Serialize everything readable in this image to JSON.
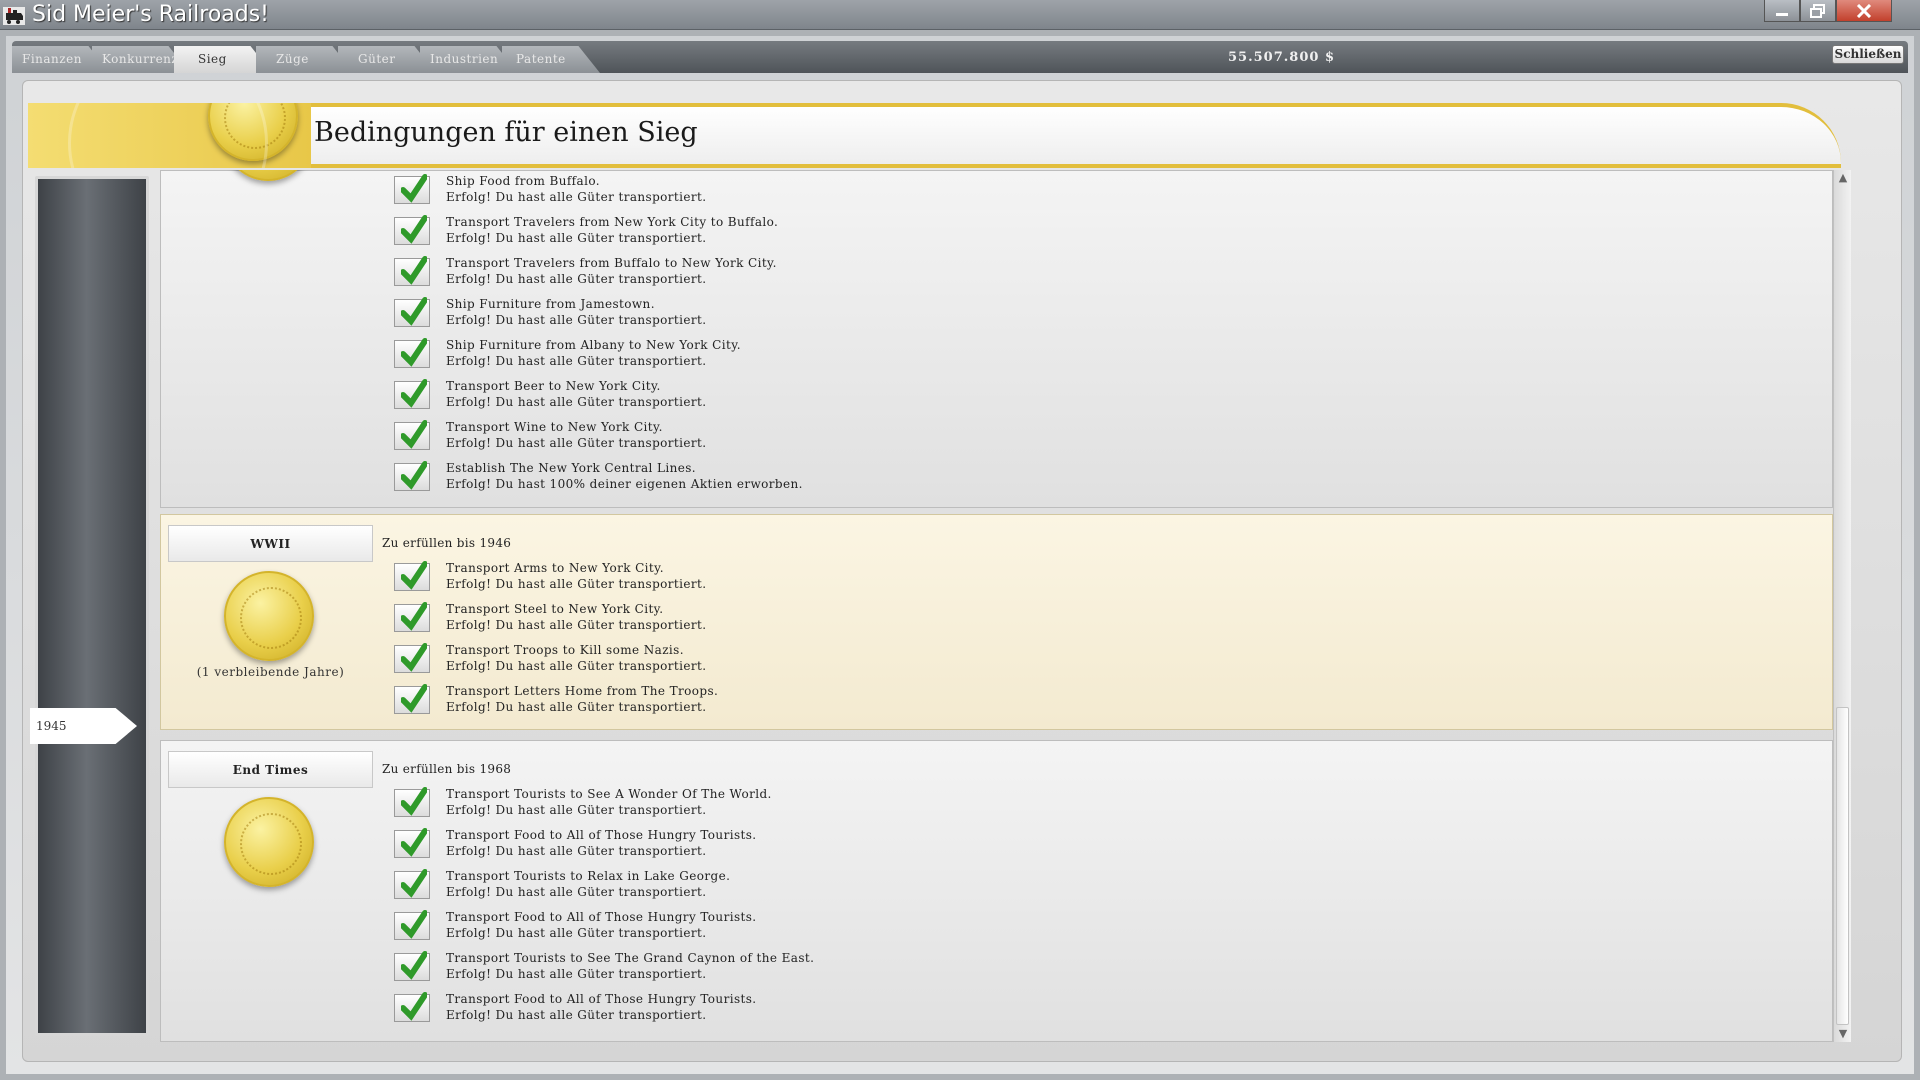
{
  "window": {
    "title": "Sid Meier's Railroads!",
    "icon": "locomotive-icon",
    "controls": [
      "minimize-icon",
      "restore-icon",
      "close-icon"
    ]
  },
  "tabs": [
    {
      "label": "Finanzen",
      "active": false
    },
    {
      "label": "Konkurrenz",
      "active": false
    },
    {
      "label": "Sieg",
      "active": true
    },
    {
      "label": "Züge",
      "active": false
    },
    {
      "label": "Güter",
      "active": false
    },
    {
      "label": "Industrien",
      "active": false
    },
    {
      "label": "Patente",
      "active": false
    }
  ],
  "money": "55.507.800 $",
  "close_button": "Schließen",
  "page_title": "Bedingungen für einen Sieg",
  "timeline": {
    "current_year": "1945"
  },
  "colors": {
    "gold": "#e2be3c",
    "check_green": "#2f9a2a",
    "highlight_bg": "#fbf5e3"
  },
  "sections": [
    {
      "goals": [
        {
          "title": "Ship Food from Buffalo.",
          "status": "Erfolg! Du hast alle Güter transportiert."
        },
        {
          "title": "Transport Travelers from New York City to Buffalo.",
          "status": "Erfolg! Du hast alle Güter transportiert."
        },
        {
          "title": "Transport Travelers from Buffalo to New York City.",
          "status": "Erfolg! Du hast alle Güter transportiert."
        },
        {
          "title": "Ship Furniture from Jamestown.",
          "status": "Erfolg! Du hast alle Güter transportiert."
        },
        {
          "title": "Ship Furniture from Albany to New York City.",
          "status": "Erfolg! Du hast alle Güter transportiert."
        },
        {
          "title": "Transport Beer to New York City.",
          "status": "Erfolg! Du hast alle Güter transportiert."
        },
        {
          "title": "Transport Wine to New York City.",
          "status": "Erfolg! Du hast alle Güter transportiert."
        },
        {
          "title": "Establish The New York Central Lines.",
          "status": "Erfolg! Du hast 100% deiner eigenen Aktien erworben."
        }
      ]
    },
    {
      "name": "WWII",
      "deadline": "Zu erfüllen bis 1946",
      "remaining": "(1 verbleibende Jahre)",
      "goals": [
        {
          "title": "Transport Arms to New York City.",
          "status": "Erfolg! Du hast alle Güter transportiert."
        },
        {
          "title": "Transport Steel to New York City.",
          "status": "Erfolg! Du hast alle Güter transportiert."
        },
        {
          "title": "Transport Troops to Kill some Nazis.",
          "status": "Erfolg! Du hast alle Güter transportiert."
        },
        {
          "title": "Transport Letters Home from The Troops.",
          "status": "Erfolg! Du hast alle Güter transportiert."
        }
      ]
    },
    {
      "name": "End Times",
      "deadline": "Zu erfüllen bis 1968",
      "goals": [
        {
          "title": "Transport Tourists to See A Wonder Of The World.",
          "status": "Erfolg! Du hast alle Güter transportiert."
        },
        {
          "title": "Transport Food to All of Those Hungry Tourists.",
          "status": "Erfolg! Du hast alle Güter transportiert."
        },
        {
          "title": "Transport Tourists to Relax in Lake George.",
          "status": "Erfolg! Du hast alle Güter transportiert."
        },
        {
          "title": "Transport Food to All of Those Hungry Tourists.",
          "status": "Erfolg! Du hast alle Güter transportiert."
        },
        {
          "title": "Transport Tourists to See The Grand Caynon of the East.",
          "status": "Erfolg! Du hast alle Güter transportiert."
        },
        {
          "title": "Transport Food to All of Those Hungry Tourists.",
          "status": "Erfolg! Du hast alle Güter transportiert."
        }
      ]
    }
  ]
}
